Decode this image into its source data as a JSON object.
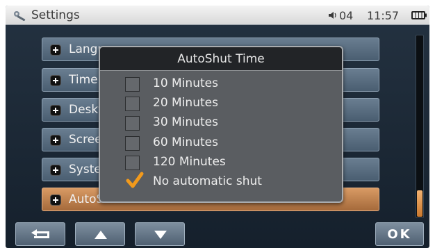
{
  "statusbar": {
    "title": "Settings",
    "app_icon": "wrench-gear-icon",
    "volume_icon": "speaker-icon",
    "volume": "04",
    "clock": "11:57",
    "battery_icon": "battery-icon"
  },
  "menu": {
    "items": [
      {
        "label": "Language"
      },
      {
        "label": "Time"
      },
      {
        "label": "Desktop"
      },
      {
        "label": "Screen"
      },
      {
        "label": "System"
      },
      {
        "label": "AutoShut Time",
        "active": true
      }
    ]
  },
  "dialog": {
    "title": "AutoShut Time",
    "options": [
      {
        "label": "10 Minutes",
        "checked": false
      },
      {
        "label": "20 Minutes",
        "checked": false
      },
      {
        "label": "30 Minutes",
        "checked": false
      },
      {
        "label": "60 Minutes",
        "checked": false
      },
      {
        "label": "120 Minutes",
        "checked": false
      },
      {
        "label": "No automatic shut",
        "checked": true
      }
    ]
  },
  "toolbar": {
    "back_icon": "back-arrow-icon",
    "up_icon": "up-triangle-icon",
    "down_icon": "down-triangle-icon",
    "ok_label": "OK"
  },
  "colors": {
    "accent": "#d89a64",
    "check": "#f29a1c"
  }
}
